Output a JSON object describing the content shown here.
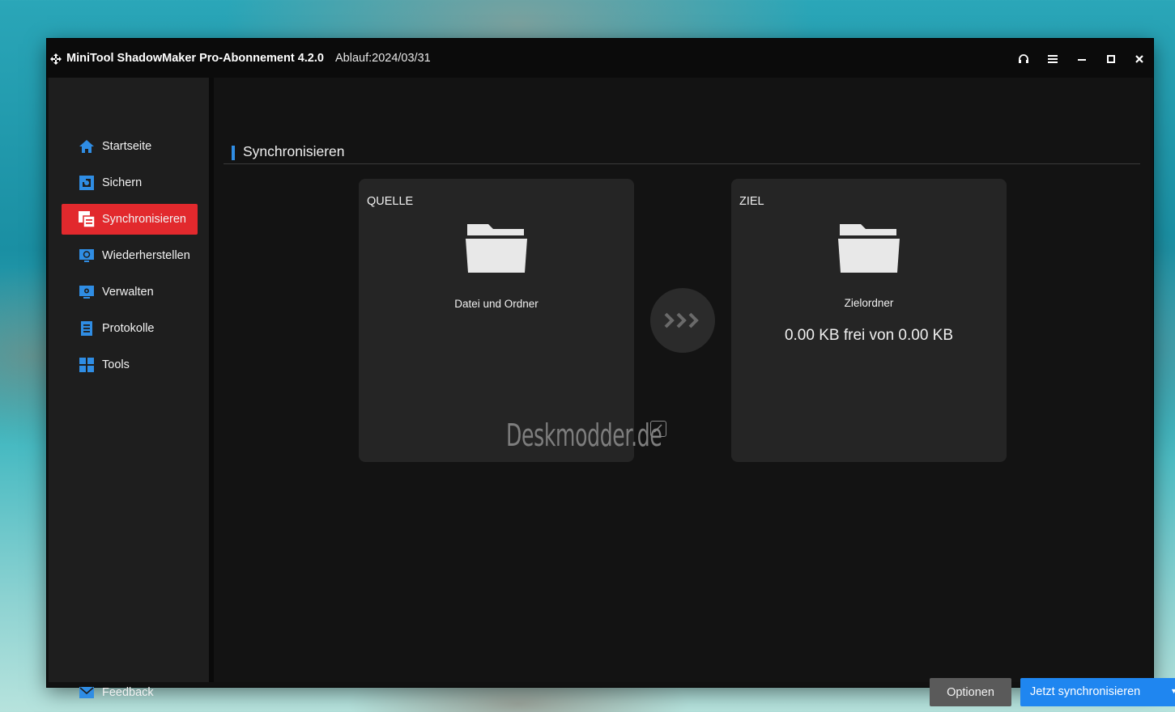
{
  "window": {
    "title": "MiniTool ShadowMaker Pro-Abonnement 4.2.0",
    "expiry": "Ablauf:2024/03/31"
  },
  "sidebar": {
    "items": [
      {
        "label": "Startseite",
        "icon": "home-icon"
      },
      {
        "label": "Sichern",
        "icon": "backup-icon"
      },
      {
        "label": "Synchronisieren",
        "icon": "sync-icon",
        "active": true
      },
      {
        "label": "Wiederherstellen",
        "icon": "restore-icon"
      },
      {
        "label": "Verwalten",
        "icon": "manage-icon"
      },
      {
        "label": "Protokolle",
        "icon": "log-icon"
      },
      {
        "label": "Tools",
        "icon": "tools-icon"
      }
    ],
    "feedback": {
      "label": "Feedback",
      "icon": "mail-icon"
    }
  },
  "main": {
    "section_title": "Synchronisieren",
    "source": {
      "heading": "QUELLE",
      "label": "Datei und Ordner"
    },
    "target": {
      "heading": "ZIEL",
      "label": "Zielordner",
      "capacity": "0.00 KB frei von 0.00 KB"
    },
    "watermark": "Deskmodder.de",
    "options_button": "Optionen",
    "sync_button": "Jetzt synchronisieren"
  },
  "colors": {
    "accent_active": "#e2292d",
    "accent_blue": "#1f86f0",
    "background": "#131313",
    "card": "#252525"
  }
}
